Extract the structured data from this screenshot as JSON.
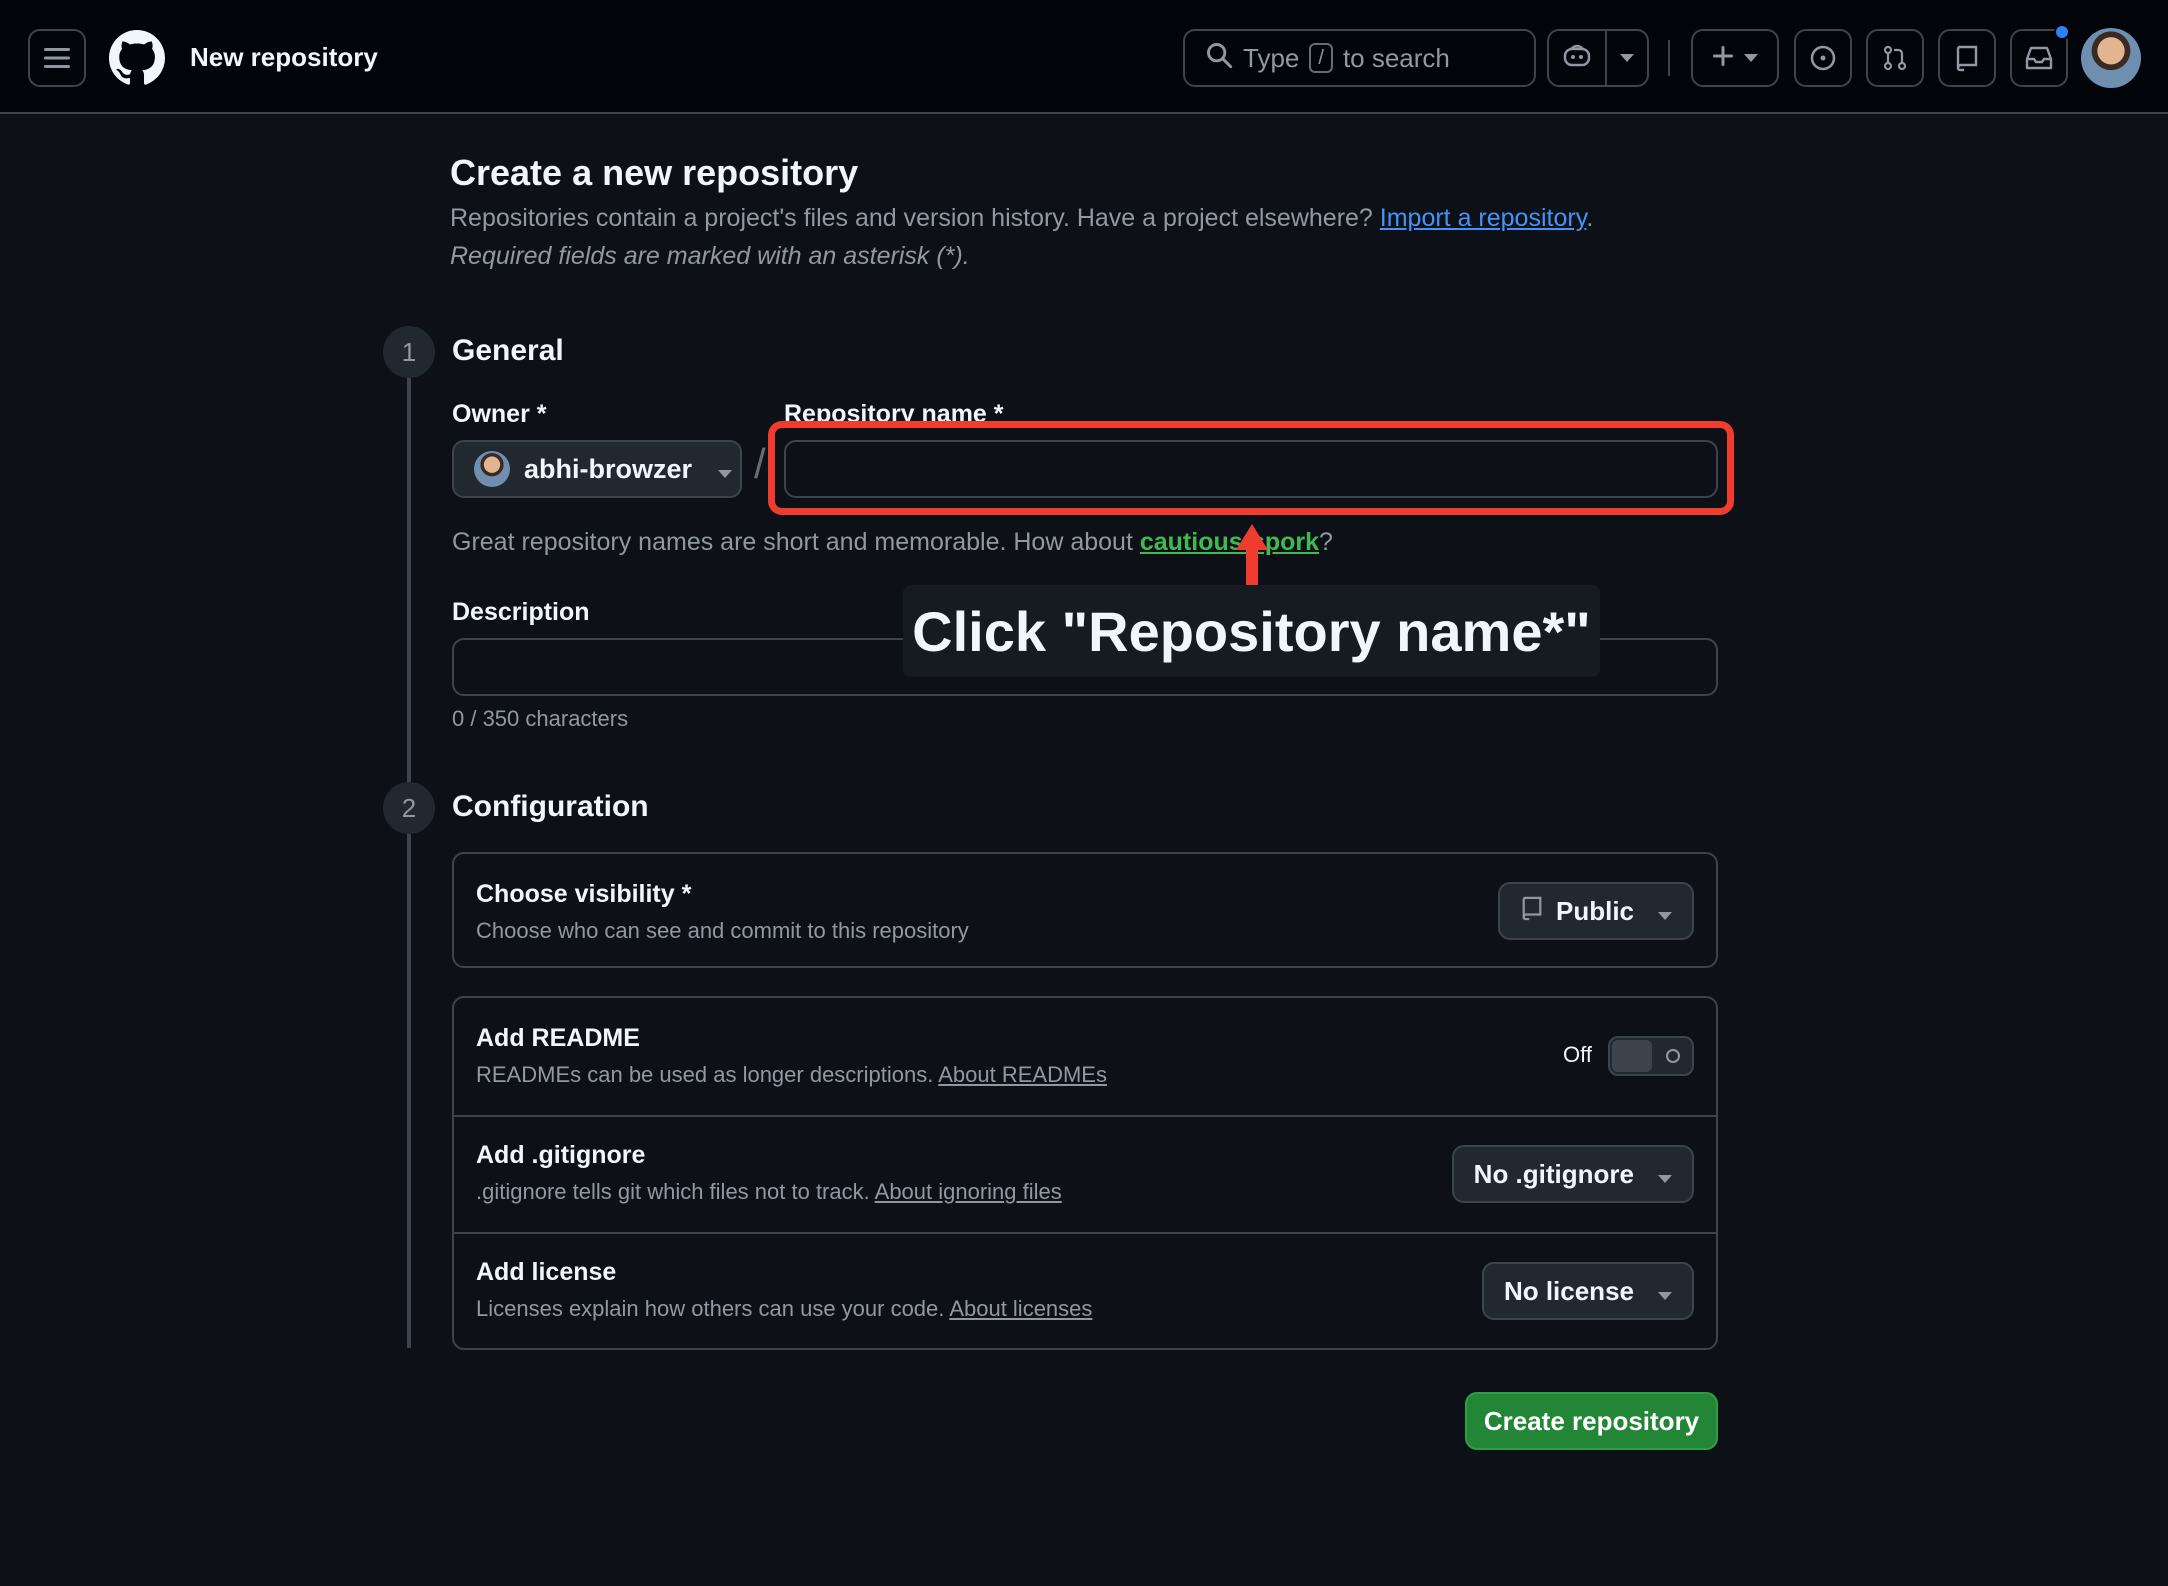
{
  "header": {
    "title": "New repository",
    "search_prefix": "Type",
    "search_key": "/",
    "search_suffix": "to search",
    "icons": [
      "hamburger-icon",
      "github-logo-icon",
      "search-icon",
      "copilot-icon",
      "plus-icon",
      "issues-icon",
      "pull-requests-icon",
      "repo-icon",
      "inbox-icon"
    ]
  },
  "page": {
    "title": "Create a new repository",
    "intro_text": "Repositories contain a project's files and version history. Have a project elsewhere?",
    "import_link": "Import a repository",
    "intro_end": ".",
    "required_note": "Required fields are marked with an asterisk (*)."
  },
  "general": {
    "step": "1",
    "heading": "General",
    "owner_label": "Owner *",
    "owner_value": "abhi-browzer",
    "separator": "/",
    "repo_name_label": "Repository name *",
    "repo_name_value": "",
    "hint_prefix": "Great repository names are short and memorable. How about",
    "hint_suggestion": "cautious-spork",
    "hint_suffix": "?",
    "description_label": "Description",
    "description_value": "",
    "char_counter": "0 / 350 characters"
  },
  "configuration": {
    "step": "2",
    "heading": "Configuration",
    "visibility": {
      "title": "Choose visibility *",
      "desc": "Choose who can see and commit to this repository",
      "value": "Public"
    },
    "readme": {
      "title": "Add README",
      "desc": "READMEs can be used as longer descriptions.",
      "link": "About READMEs",
      "toggle_state": "Off"
    },
    "gitignore": {
      "title": "Add .gitignore",
      "desc": ".gitignore tells git which files not to track.",
      "link": "About ignoring files",
      "value": "No .gitignore"
    },
    "license": {
      "title": "Add license",
      "desc": "Licenses explain how others can use your code.",
      "link": "About licenses",
      "value": "No license"
    }
  },
  "actions": {
    "create_label": "Create repository"
  },
  "annotation": {
    "callout_text": "Click \"Repository name*\"",
    "highlight_color": "#f03c2e"
  },
  "colors": {
    "background": "#0d1117",
    "header_bg": "#010409",
    "accent_link": "#4493f8",
    "suggestion_green": "#3fb950",
    "primary_button": "#238636",
    "notification_dot": "#2f81f7"
  }
}
